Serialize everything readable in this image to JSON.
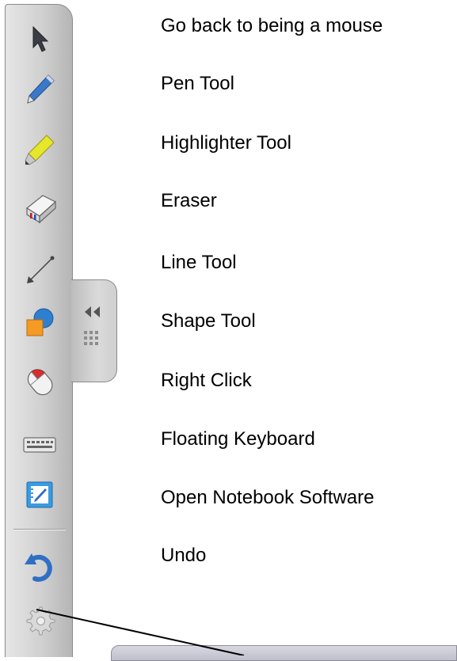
{
  "toolbar": {
    "items": [
      {
        "icon": "select-arrow-icon",
        "label": "Go back to being a mouse"
      },
      {
        "icon": "pen-icon",
        "label": "Pen Tool"
      },
      {
        "icon": "highlighter-icon",
        "label": "Highlighter Tool"
      },
      {
        "icon": "eraser-icon",
        "label": "Eraser"
      },
      {
        "icon": "line-icon",
        "label": "Line Tool"
      },
      {
        "icon": "shapes-icon",
        "label": "Shape Tool"
      },
      {
        "icon": "right-click-mouse-icon",
        "label": "Right Click"
      },
      {
        "icon": "keyboard-icon",
        "label": "Floating Keyboard"
      },
      {
        "icon": "notebook-icon",
        "label": "Open Notebook Software"
      },
      {
        "icon": "undo-icon",
        "label": "Undo"
      },
      {
        "icon": "settings-gear-icon",
        "label": ""
      }
    ],
    "collapse_tab_icons": [
      "double-chevron-left-icon",
      "grip-dots-icon"
    ]
  },
  "colors": {
    "toolbar_bg": "#d0d0d0",
    "pen_blue": "#3b78c8",
    "highlighter_yellow": "#e6e62a",
    "shape_orange": "#f59a25",
    "shape_blue": "#2f7fd0",
    "mouse_red": "#d23030",
    "undo_blue": "#2f6fc4"
  }
}
